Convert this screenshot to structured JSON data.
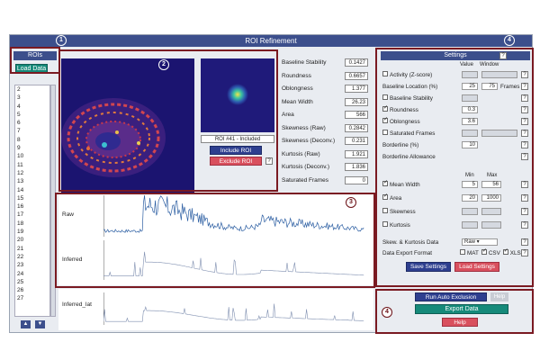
{
  "app": {
    "title": "ROI Refinement",
    "callouts": [
      "1",
      "2",
      "3",
      "4",
      "4"
    ]
  },
  "left_panel": {
    "header": "ROIs",
    "load_button": "Load Data",
    "roi_items": [
      "2",
      "3",
      "4",
      "5",
      "6",
      "7",
      "8",
      "9",
      "10",
      "11",
      "12",
      "13",
      "14",
      "15",
      "16",
      "17",
      "18",
      "19",
      "20",
      "21",
      "22",
      "23",
      "24",
      "25",
      "26",
      "27"
    ],
    "up_icon": "arrow-up-icon",
    "down_icon": "arrow-down-icon"
  },
  "roi_view": {
    "status": "ROI #41 - Included",
    "include_button": "Include ROI",
    "exclude_button": "Exclude ROI",
    "help": "?"
  },
  "metrics": [
    {
      "label": "Baseline Stability",
      "value": "0.1427"
    },
    {
      "label": "Roundness",
      "value": "0.6657"
    },
    {
      "label": "Oblongness",
      "value": "1.377"
    },
    {
      "label": "Mean Width",
      "value": "26.23"
    },
    {
      "label": "Area",
      "value": "566"
    },
    {
      "label": "Skewness (Raw)",
      "value": "0.2842"
    },
    {
      "label": "Skewness (Deconv.)",
      "value": "0.231"
    },
    {
      "label": "Kurtosis (Raw)",
      "value": "1.921"
    },
    {
      "label": "Kurtosis (Deconv.)",
      "value": "1.836"
    },
    {
      "label": "Saturated Frames",
      "value": "0"
    }
  ],
  "traces": [
    {
      "label": "Raw"
    },
    {
      "label": "Inferred"
    },
    {
      "label": "Inferred_lat"
    }
  ],
  "settings": {
    "header": "Settings",
    "header_help": "?",
    "col_value": "Value",
    "col_window": "Window",
    "col_min": "Min",
    "col_max": "Max",
    "rows": [
      {
        "label": "Activity (Z-score)",
        "checked": false,
        "value": "",
        "window": "",
        "unit": ""
      },
      {
        "label": "Baseline Location (%)",
        "checked": null,
        "value": "25",
        "window": "75",
        "unit": "Frames"
      },
      {
        "label": "Baseline Stability",
        "checked": false,
        "value": "",
        "window": "",
        "unit": ""
      },
      {
        "label": "Roundness",
        "checked": true,
        "value": "0.3",
        "window": "",
        "unit": ""
      },
      {
        "label": "Oblongness",
        "checked": true,
        "value": "3.6",
        "window": "",
        "unit": ""
      },
      {
        "label": "Saturated Frames",
        "checked": false,
        "value": "",
        "window": "",
        "unit": ""
      },
      {
        "label": "Borderline (%)",
        "checked": null,
        "value": "10",
        "window": "",
        "unit": ""
      },
      {
        "label": "Borderline Allowance",
        "checked": null,
        "value": "1",
        "window": "",
        "unit": ""
      }
    ],
    "range_rows": [
      {
        "label": "Mean Width",
        "checked": true,
        "min": "5",
        "max": "56"
      },
      {
        "label": "Area",
        "checked": true,
        "min": "20",
        "max": "1000"
      },
      {
        "label": "Skewness",
        "checked": false,
        "min": "",
        "max": ""
      },
      {
        "label": "Kurtosis",
        "checked": false,
        "min": "",
        "max": ""
      }
    ],
    "skew_label": "Skew. & Kurtosis Data",
    "skew_value": "Raw",
    "export_label": "Data Export Format",
    "formats": [
      {
        "label": "MAT",
        "checked": false
      },
      {
        "label": "CSV",
        "checked": true
      },
      {
        "label": "XLSX",
        "checked": true
      }
    ],
    "save_button": "Save Settings",
    "load_button": "Load Settings"
  },
  "actions": {
    "run_button": "Run Auto Exclusion",
    "run_help": "Help",
    "export_button": "Export Data",
    "help_button": "Help"
  },
  "colors": {
    "header_blue": "#3c4f8c",
    "green": "#168a7a",
    "red_accent": "#d9505e",
    "trace_blue": "#2d5fa3",
    "callout_red": "#7a1a22"
  }
}
